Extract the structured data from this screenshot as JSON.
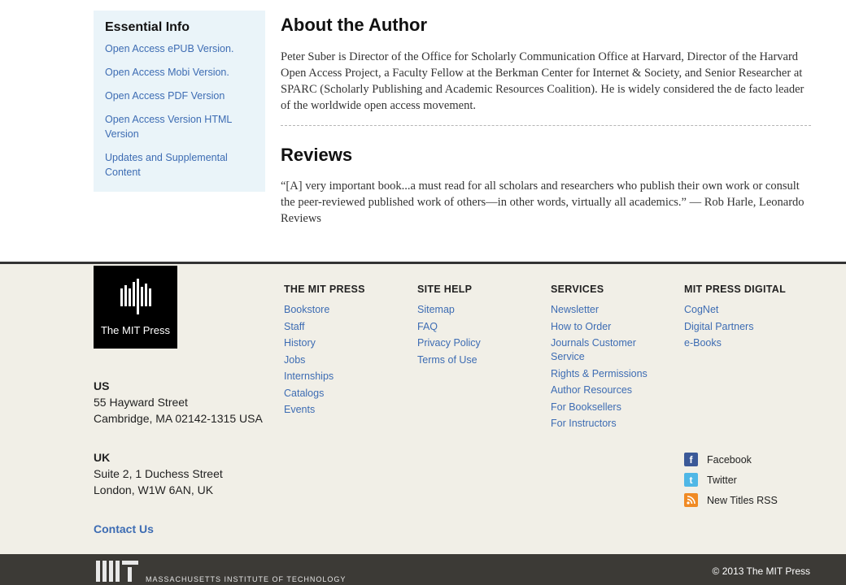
{
  "sidebar": {
    "title": "Essential Info",
    "links": [
      "Open Access ePUB Version.",
      "Open Access Mobi Version.",
      "Open Access PDF Version",
      "Open Access Version HTML Version",
      "Updates and Supplemental Content"
    ]
  },
  "main": {
    "about_title": "About the Author",
    "about_text": "Peter Suber is  Director of the Office for Scholarly Communication Office at Harvard, Director of the Harvard Open Access Project, a Faculty Fellow at the Berkman Center for Internet & Society, and Senior Researcher at SPARC (Scholarly Publishing and Academic Resources Coalition). He is widely considered the de facto leader of the worldwide open access movement.",
    "reviews_title": "Reviews",
    "reviews_text": "“[A] very important book...a must read for all scholars and researchers who publish their own work or consult the peer-reviewed published work of others—in other words, virtually all academics.” — Rob Harle, Leonardo Reviews"
  },
  "footer": {
    "logo_text": "The MIT Press",
    "us": {
      "country": "US",
      "line1": "55 Hayward Street",
      "line2": "Cambridge, MA 02142-1315 USA"
    },
    "uk": {
      "country": "UK",
      "line1": "Suite 2, 1 Duchess Street",
      "line2": "London, W1W 6AN, UK"
    },
    "contact": "Contact Us",
    "columns": [
      {
        "title": "THE MIT PRESS",
        "links": [
          "Bookstore",
          "Staff",
          "History",
          "Jobs",
          "Internships",
          "Catalogs",
          "Events"
        ]
      },
      {
        "title": "SITE HELP",
        "links": [
          "Sitemap",
          "FAQ",
          "Privacy Policy",
          "Terms of Use"
        ]
      },
      {
        "title": "SERVICES",
        "links": [
          "Newsletter",
          "How to Order",
          "Journals Customer Service",
          "Rights & Permissions",
          "Author Resources",
          "For Booksellers",
          "For Instructors"
        ]
      },
      {
        "title": "MIT PRESS DIGITAL",
        "links": [
          "CogNet",
          "Digital Partners",
          "e-Books"
        ]
      }
    ],
    "social": [
      {
        "label": "Facebook",
        "icon": "facebook-icon",
        "color": "#3b5998"
      },
      {
        "label": "Twitter",
        "icon": "twitter-icon",
        "color": "#4fb7e6"
      },
      {
        "label": "New Titles RSS",
        "icon": "rss-icon",
        "color": "#f08a24"
      }
    ]
  },
  "bottom": {
    "institute": "MASSACHUSETTS INSTITUTE OF TECHNOLOGY",
    "copyright": "© 2013 The MIT Press"
  }
}
